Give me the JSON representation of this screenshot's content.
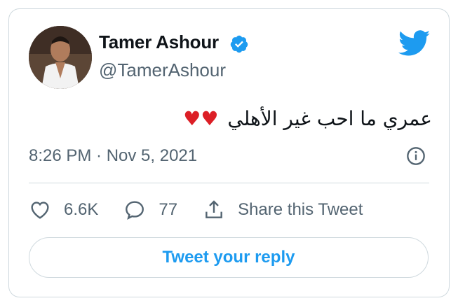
{
  "author": {
    "display_name": "Tamer Ashour",
    "handle": "@TamerAshour",
    "verified": true
  },
  "tweet": {
    "text": "عمري ما احب غير الأهلي",
    "emoji": "heart-emoji-x2",
    "timestamp": "8:26 PM · Nov 5, 2021"
  },
  "actions": {
    "like_count": "6.6K",
    "reply_count": "77",
    "share_label": "Share this Tweet"
  },
  "reply_button": "Tweet your reply",
  "colors": {
    "accent": "#1d9bf0",
    "text_secondary": "#536471",
    "border": "#cfd9de",
    "heart": "#dc1f26"
  },
  "icons": [
    "verified-icon",
    "twitter-bird-icon",
    "info-icon",
    "like-icon",
    "reply-icon",
    "share-icon"
  ]
}
